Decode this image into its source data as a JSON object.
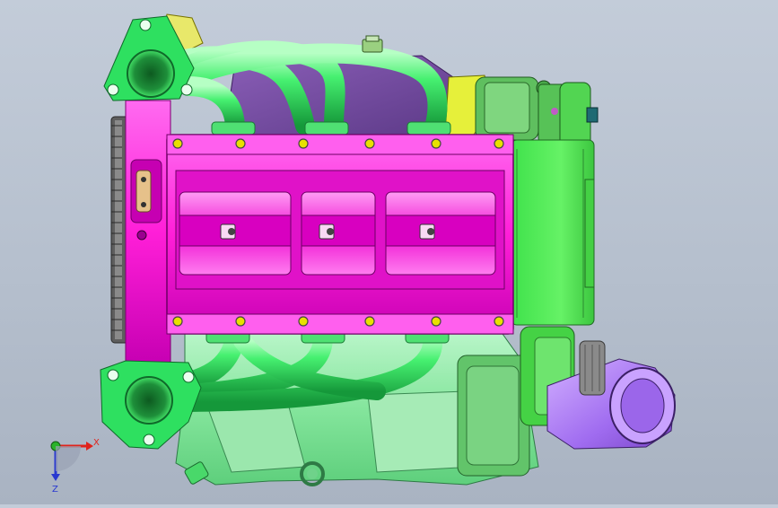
{
  "viewport": {
    "background_top": "#c3ccd9",
    "background_bottom": "#a9b3c2"
  },
  "model": {
    "colors": {
      "intake_manifold": "#ff2fe0",
      "intake_manifold_dark": "#c400b0",
      "exhaust_pipe": "#3cf26a",
      "exhaust_pipe_dark": "#1c9f3c",
      "exhaust_flange": "#2ee060",
      "gearbox_housing": "#52ee52",
      "lower_block": "#8ff0a6",
      "cover_plate": "#7a4fa8",
      "turbo_inlet": "#b07cf5",
      "alternator": "#5fbf5f",
      "flywheel": "#7a7a7a",
      "yellow_bracket": "#e6f03a",
      "bolt": "#e8e000"
    }
  },
  "triad": {
    "x_label": "X",
    "z_label": "Z",
    "x_color": "#e0231c",
    "y_color": "#2ab32a",
    "z_color": "#2838d0"
  }
}
